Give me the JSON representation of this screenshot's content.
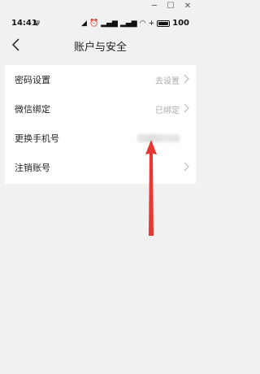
{
  "window_controls": {
    "minimize": "─",
    "maximize": "☐",
    "close": "✕"
  },
  "status_bar": {
    "time": "14:41",
    "left_icon": "usb-icon",
    "right_icons": [
      "silent-icon",
      "alarm-icon",
      "signal-icon",
      "signal-icon",
      "wifi-icon",
      "charging-icon",
      "battery-icon"
    ],
    "battery_level": "100"
  },
  "nav": {
    "title": "账户与安全",
    "back_icon": "back-chevron-icon"
  },
  "settings": {
    "items": [
      {
        "label": "密码设置",
        "value": "去设置"
      },
      {
        "label": "微信绑定",
        "value": "已绑定"
      },
      {
        "label": "更换手机号",
        "value": ""
      },
      {
        "label": "注销账号",
        "value": ""
      }
    ]
  },
  "annotation": {
    "arrow_color": "#e53935"
  }
}
